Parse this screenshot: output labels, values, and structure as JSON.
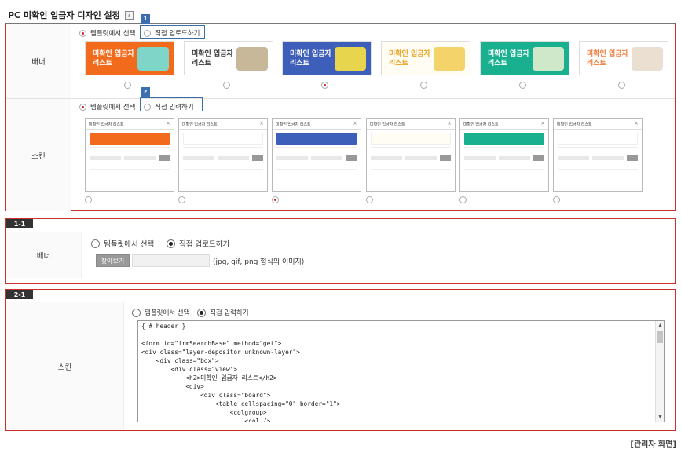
{
  "header": {
    "title": "PC 미확인 입금자 디자인 설정",
    "help": "?"
  },
  "section1": {
    "banner": {
      "label": "배너",
      "option_template": "템플릿에서 선택",
      "option_upload": "직접 업로드하기",
      "callout_number": "1",
      "banners": [
        {
          "line1": "미확인 입금자",
          "line2": "리스트",
          "bg": "#f26a1b",
          "fg": "#ffffff",
          "deco": "#7fd6c8",
          "selected": false
        },
        {
          "line1": "미확인 입금자",
          "line2": "리스트",
          "bg": "#ffffff",
          "fg": "#333333",
          "deco": "#c8b89a",
          "selected": false
        },
        {
          "line1": "미확인 입금자",
          "line2": "리스트",
          "bg": "#3e5fb9",
          "fg": "#ffffff",
          "deco": "#e7d54d",
          "selected": true
        },
        {
          "line1": "미확인 입금자",
          "line2": "리스트",
          "bg": "#fffdf4",
          "fg": "#e8a21c",
          "deco": "#f3d36a",
          "selected": false
        },
        {
          "line1": "미확인 입금자",
          "line2": "리스트",
          "bg": "#19b08f",
          "fg": "#ffffff",
          "deco": "#cfe8c9",
          "selected": false
        },
        {
          "line1": "미확인 입금자",
          "line2": "리스트",
          "bg": "#ffffff",
          "fg": "#f07a3a",
          "deco": "#eadfd0",
          "selected": false
        }
      ]
    },
    "skin": {
      "label": "스킨",
      "option_template": "템플릿에서 선택",
      "option_input": "직접 입력하기",
      "callout_number": "2",
      "skins": [
        {
          "title": "미확인 입금자 리스트",
          "strip": "#f26a1b",
          "selected": false
        },
        {
          "title": "미확인 입금자 리스트",
          "strip": "#ffffff",
          "selected": false
        },
        {
          "title": "미확인 입금자 리스트",
          "strip": "#3e5fb9",
          "selected": true
        },
        {
          "title": "미확인 입금자 리스트",
          "strip": "#fffdf4",
          "selected": false
        },
        {
          "title": "미확인 입금자 리스트",
          "strip": "#19b08f",
          "selected": false
        },
        {
          "title": "미확인 입금자 리스트",
          "strip": "#ffffff",
          "selected": false
        }
      ]
    }
  },
  "section2": {
    "tag": "1-1",
    "label": "배너",
    "option_template": "템플릿에서 선택",
    "option_upload": "직접 업로드하기",
    "browse_label": "찾아보기",
    "hint": "(jpg, gif, png 형식의 이미지)"
  },
  "section3": {
    "tag": "2-1",
    "label": "스킨",
    "option_template": "템플릿에서 선택",
    "option_input": "직접 입력하기",
    "code": "{ # header }\n\n<form id=\"frmSearchBase\" method=\"get\">\n<div class=\"layer-depositor unknown-layer\">\n    <div class=\"box\">\n        <div class=\"view\">\n            <h2>미확인 입금자 리스트</h2>\n            <div>\n                <div class=\"board\">\n                    <table cellspacing=\"0\" border=\"1\">\n                        <colgroup>\n                            <col />"
  },
  "footer": {
    "caption": "[관리자 화면]"
  },
  "colors": {
    "accent_red": "#c9302c",
    "callout_blue": "#3a6ea8"
  }
}
